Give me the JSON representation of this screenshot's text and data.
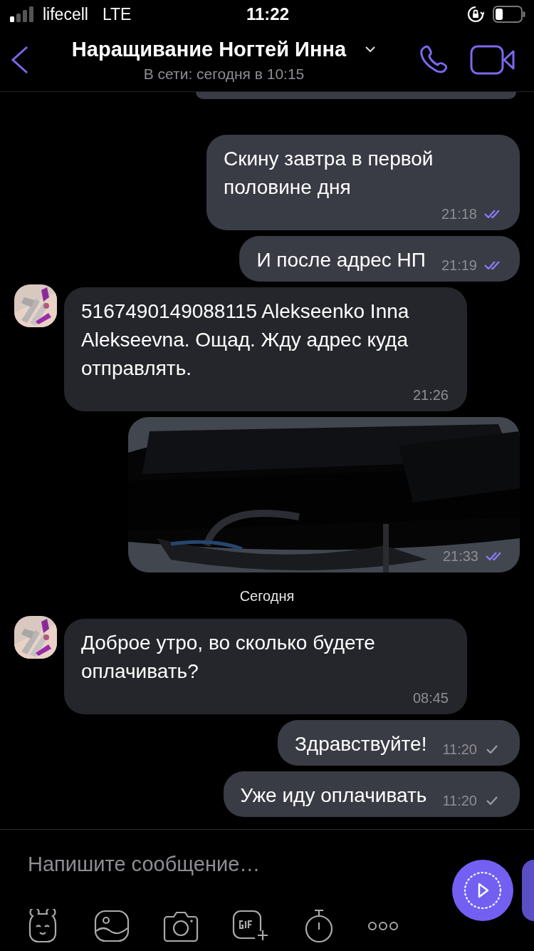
{
  "status_bar": {
    "carrier": "lifecell",
    "network": "LTE",
    "time": "11:22"
  },
  "header": {
    "title": "Наращивание Ногтей Инна",
    "subtitle": "В сети: сегодня в 10:15"
  },
  "messages": [
    {
      "kind": "stub"
    },
    {
      "kind": "text",
      "outgoing": true,
      "text": "Скину завтра в первой половине дня",
      "time": "21:18",
      "read": true
    },
    {
      "kind": "text",
      "outgoing": true,
      "text": "И после адрес НП",
      "time": "21:19",
      "read": true
    },
    {
      "kind": "text",
      "outgoing": false,
      "text": "5167490149088115 Alekseenko Inna Alekseevna. Ощад. Жду адрес куда отправлять.",
      "time": "21:26"
    },
    {
      "outgoing": true,
      "time": "21:33",
      "read": true
    },
    {
      "kind": "date",
      "text": "Сегодня"
    },
    {
      "kind": "text",
      "outgoing": false,
      "text": "Доброе утро, во сколько будете оплачивать?",
      "time": "08:45"
    },
    {
      "kind": "text",
      "outgoing": true,
      "text": "Здравствуйте!",
      "time": "11:20",
      "read": false
    },
    {
      "kind": "text",
      "outgoing": true,
      "text": "Уже иду оплачивать",
      "time": "11:20",
      "read": false
    }
  ],
  "composer": {
    "placeholder": "Напишите сообщение…"
  }
}
